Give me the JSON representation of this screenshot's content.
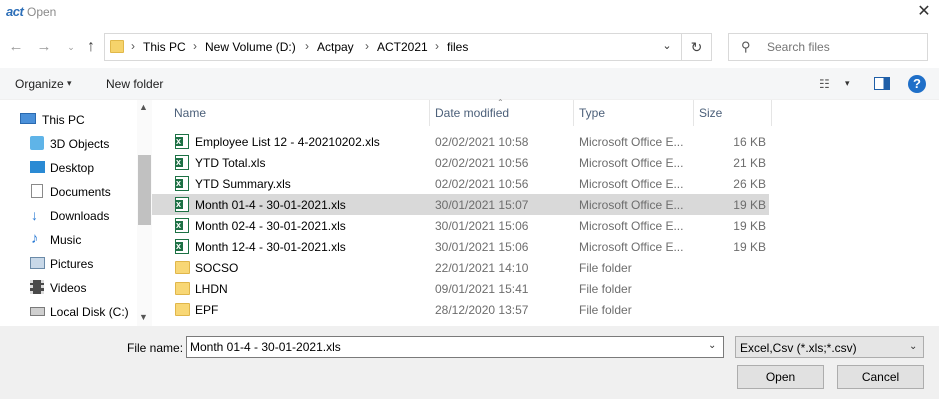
{
  "window": {
    "logo": "act",
    "title": "Open",
    "close_glyph": "✕"
  },
  "nav": {
    "back_glyph": "←",
    "forward_glyph": "→",
    "recent_glyph": "⌄",
    "up_glyph": "↑",
    "refresh_glyph": "↻",
    "dropdown_glyph": "⌄"
  },
  "address": {
    "crumbs": [
      "This PC",
      "New Volume (D:)",
      "Actpay",
      "ACT2021",
      "files"
    ],
    "separator": "›"
  },
  "search": {
    "placeholder": "Search files",
    "icon_glyph": "⚲"
  },
  "toolbar": {
    "organize": "Organize",
    "new_folder": "New folder",
    "caret": "▾",
    "view_glyph": "☷",
    "help_glyph": "?"
  },
  "sidebar": {
    "items": [
      {
        "label": "This PC",
        "icon": "computer-icon",
        "color": "#4a90d9"
      },
      {
        "label": "3D Objects",
        "icon": "3d-objects-icon",
        "color": "#5fb4e8"
      },
      {
        "label": "Desktop",
        "icon": "desktop-icon",
        "color": "#2a8ad4"
      },
      {
        "label": "Documents",
        "icon": "documents-icon",
        "color": "#8a8a8a"
      },
      {
        "label": "Downloads",
        "icon": "downloads-icon",
        "color": "#2a7ad4"
      },
      {
        "label": "Music",
        "icon": "music-icon",
        "color": "#2a7ad4"
      },
      {
        "label": "Pictures",
        "icon": "pictures-icon",
        "color": "#6a8aa8"
      },
      {
        "label": "Videos",
        "icon": "videos-icon",
        "color": "#4a4a4a"
      },
      {
        "label": "Local Disk (C:)",
        "icon": "disk-icon",
        "color": "#7a7a7a"
      }
    ],
    "scroll_up": "▲",
    "scroll_down": "▼"
  },
  "columns": {
    "name": "Name",
    "date": "Date modified",
    "type": "Type",
    "size": "Size",
    "sort_glyph": "⌃"
  },
  "files": [
    {
      "name": "Employee List 12 - 4-20210202.xls",
      "date": "02/02/2021 10:58",
      "type": "Microsoft Office E...",
      "size": "16 KB",
      "kind": "xls",
      "selected": false
    },
    {
      "name": "YTD Total.xls",
      "date": "02/02/2021 10:56",
      "type": "Microsoft Office E...",
      "size": "21 KB",
      "kind": "xls",
      "selected": false
    },
    {
      "name": "YTD Summary.xls",
      "date": "02/02/2021 10:56",
      "type": "Microsoft Office E...",
      "size": "26 KB",
      "kind": "xls",
      "selected": false
    },
    {
      "name": "Month 01-4 - 30-01-2021.xls",
      "date": "30/01/2021 15:07",
      "type": "Microsoft Office E...",
      "size": "19 KB",
      "kind": "xls",
      "selected": true
    },
    {
      "name": "Month 02-4 - 30-01-2021.xls",
      "date": "30/01/2021 15:06",
      "type": "Microsoft Office E...",
      "size": "19 KB",
      "kind": "xls",
      "selected": false
    },
    {
      "name": "Month 12-4 - 30-01-2021.xls",
      "date": "30/01/2021 15:06",
      "type": "Microsoft Office E...",
      "size": "19 KB",
      "kind": "xls",
      "selected": false
    },
    {
      "name": "SOCSO",
      "date": "22/01/2021 14:10",
      "type": "File folder",
      "size": "",
      "kind": "folder",
      "selected": false
    },
    {
      "name": "LHDN",
      "date": "09/01/2021 15:41",
      "type": "File folder",
      "size": "",
      "kind": "folder",
      "selected": false
    },
    {
      "name": "EPF",
      "date": "28/12/2020 13:57",
      "type": "File folder",
      "size": "",
      "kind": "folder",
      "selected": false
    }
  ],
  "bottom": {
    "filename_label": "File name:",
    "filename_value": "Month 01-4 - 30-01-2021.xls",
    "filter": "Excel,Csv (*.xls;*.csv)",
    "caret": "⌄",
    "open": "Open",
    "cancel": "Cancel"
  }
}
